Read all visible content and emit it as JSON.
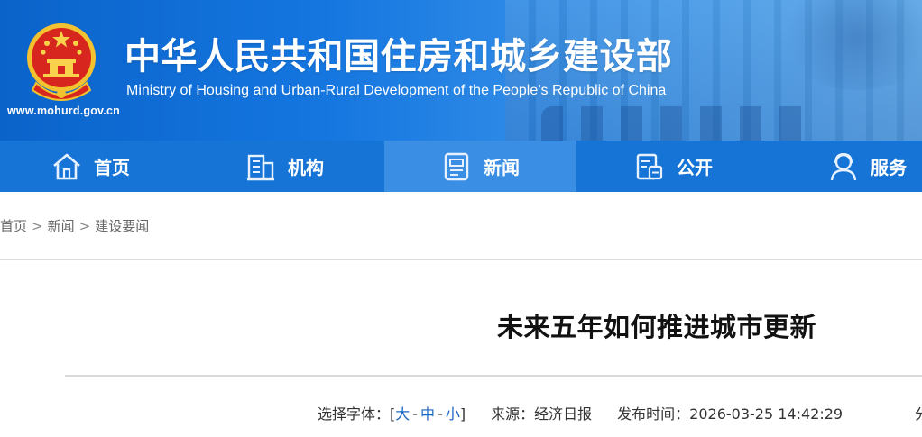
{
  "header": {
    "title_cn": "中华人民共和国住房和城乡建设部",
    "title_en": "Ministry of Housing and Urban-Rural Development of the People’s Republic of China",
    "site_url": "www.mohurd.gov.cn",
    "emblem_icon": "national-emblem-icon"
  },
  "nav": {
    "items": [
      {
        "label": "首页",
        "icon": "home-icon"
      },
      {
        "label": "机构",
        "icon": "building-icon"
      },
      {
        "label": "新闻",
        "icon": "newspaper-icon"
      },
      {
        "label": "公开",
        "icon": "document-icon"
      },
      {
        "label": "服务",
        "icon": "service-user-icon"
      }
    ],
    "active_index": 2
  },
  "breadcrumb": {
    "items": [
      "首页",
      "新闻",
      "建设要闻"
    ],
    "separator": ">"
  },
  "article": {
    "title": "未来五年如何推进城市更新",
    "font_select_label": "选择字体：[",
    "font_options": [
      "大",
      "中",
      "小"
    ],
    "font_select_close": "]",
    "source_label": "来源：",
    "source_value": "经济日报",
    "publish_label": "发布时间：",
    "publish_value": "2026-03-25 14:42:29",
    "extra_clipped": "分"
  },
  "colors": {
    "banner_blue": "#0a63c9",
    "nav_blue": "#1674d6",
    "nav_active": "#3a8fe4",
    "link_blue": "#1a66c2"
  }
}
